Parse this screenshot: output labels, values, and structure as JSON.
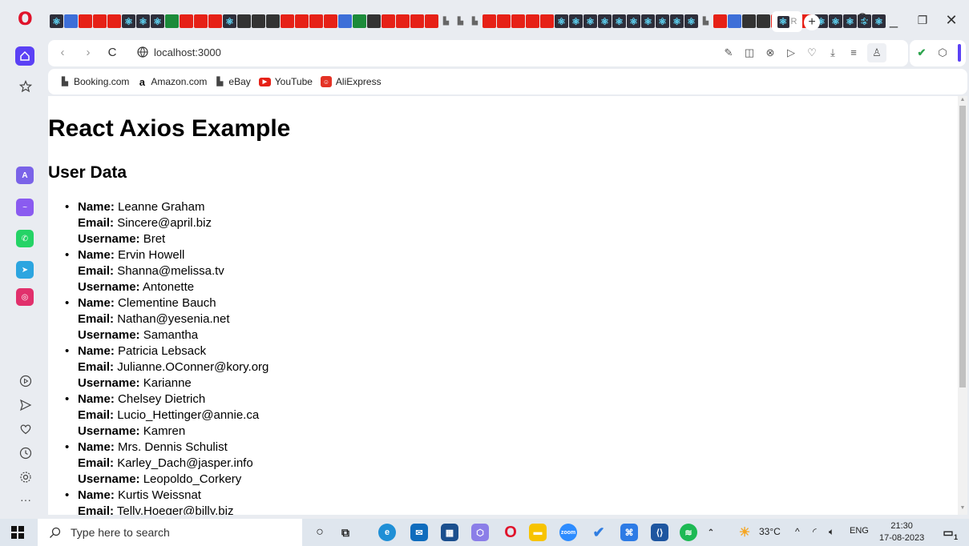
{
  "browser": {
    "url": "localhost:3000",
    "active_tab_label": "R",
    "bookmarks": [
      {
        "label": "Booking.com",
        "icon": "page-icon"
      },
      {
        "label": "Amazon.com",
        "icon": "amazon-icon"
      },
      {
        "label": "eBay",
        "icon": "page-icon"
      },
      {
        "label": "YouTube",
        "icon": "youtube-icon"
      },
      {
        "label": "AliExpress",
        "icon": "aliexpress-icon"
      }
    ]
  },
  "page": {
    "title": "React Axios Example",
    "subtitle": "User Data",
    "field_labels": {
      "name": "Name:",
      "email": "Email:",
      "username": "Username:"
    },
    "users": [
      {
        "name": "Leanne Graham",
        "email": "Sincere@april.biz",
        "username": "Bret"
      },
      {
        "name": "Ervin Howell",
        "email": "Shanna@melissa.tv",
        "username": "Antonette"
      },
      {
        "name": "Clementine Bauch",
        "email": "Nathan@yesenia.net",
        "username": "Samantha"
      },
      {
        "name": "Patricia Lebsack",
        "email": "Julianne.OConner@kory.org",
        "username": "Karianne"
      },
      {
        "name": "Chelsey Dietrich",
        "email": "Lucio_Hettinger@annie.ca",
        "username": "Kamren"
      },
      {
        "name": "Mrs. Dennis Schulist",
        "email": "Karley_Dach@jasper.info",
        "username": "Leopoldo_Corkery"
      },
      {
        "name": "Kurtis Weissnat",
        "email": "Telly.Hoeger@billy.biz",
        "username": ""
      }
    ]
  },
  "taskbar": {
    "search_placeholder": "Type here to search",
    "temperature": "33°C",
    "language": "ENG",
    "time": "21:30",
    "date": "17-08-2023",
    "notification_count": "1"
  },
  "colors": {
    "opera_red": "#e0132b",
    "opera_accent": "#5b41f5"
  }
}
